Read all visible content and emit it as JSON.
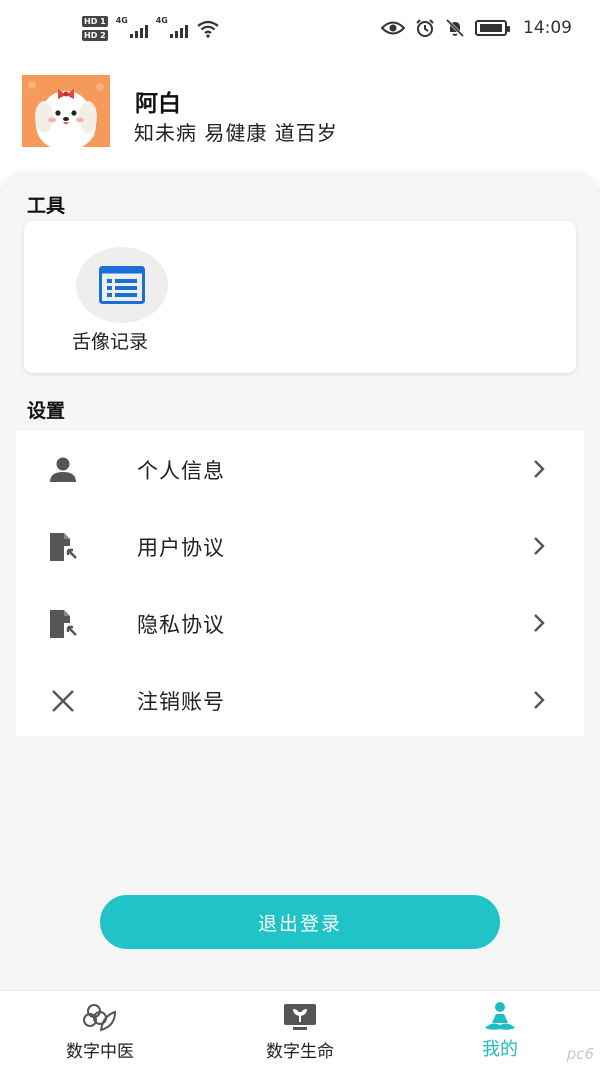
{
  "status_bar": {
    "sim1": "HD 1",
    "sim2": "HD 2",
    "net1": "4G",
    "net2": "4G",
    "time": "14:09",
    "icons": [
      "eye-icon",
      "alarm-icon",
      "mute-icon",
      "battery-icon"
    ]
  },
  "profile": {
    "name": "阿白",
    "motto": "知未病  易健康  道百岁",
    "avatar_icon": "cartoon-dog-avatar"
  },
  "tools": {
    "title": "工具",
    "items": [
      {
        "label": "舌像记录",
        "icon": "list-document-icon",
        "color": "#1a6fd6"
      }
    ]
  },
  "settings": {
    "title": "设置",
    "items": [
      {
        "label": "个人信息",
        "icon": "person-icon"
      },
      {
        "label": "用户协议",
        "icon": "file-export-icon"
      },
      {
        "label": "隐私协议",
        "icon": "file-export-icon"
      },
      {
        "label": "注销账号",
        "icon": "close-icon"
      }
    ]
  },
  "logout": {
    "label": "退出登录",
    "color": "#1fc3c8"
  },
  "bottom_nav": {
    "items": [
      {
        "label": "数字中医",
        "icon": "herb-icon",
        "active": false
      },
      {
        "label": "数字生命",
        "icon": "plant-screen-icon",
        "active": false
      },
      {
        "label": "我的",
        "icon": "meditation-person-icon",
        "active": true
      }
    ],
    "active_color": "#1fbcc2"
  },
  "watermark": "pc6"
}
